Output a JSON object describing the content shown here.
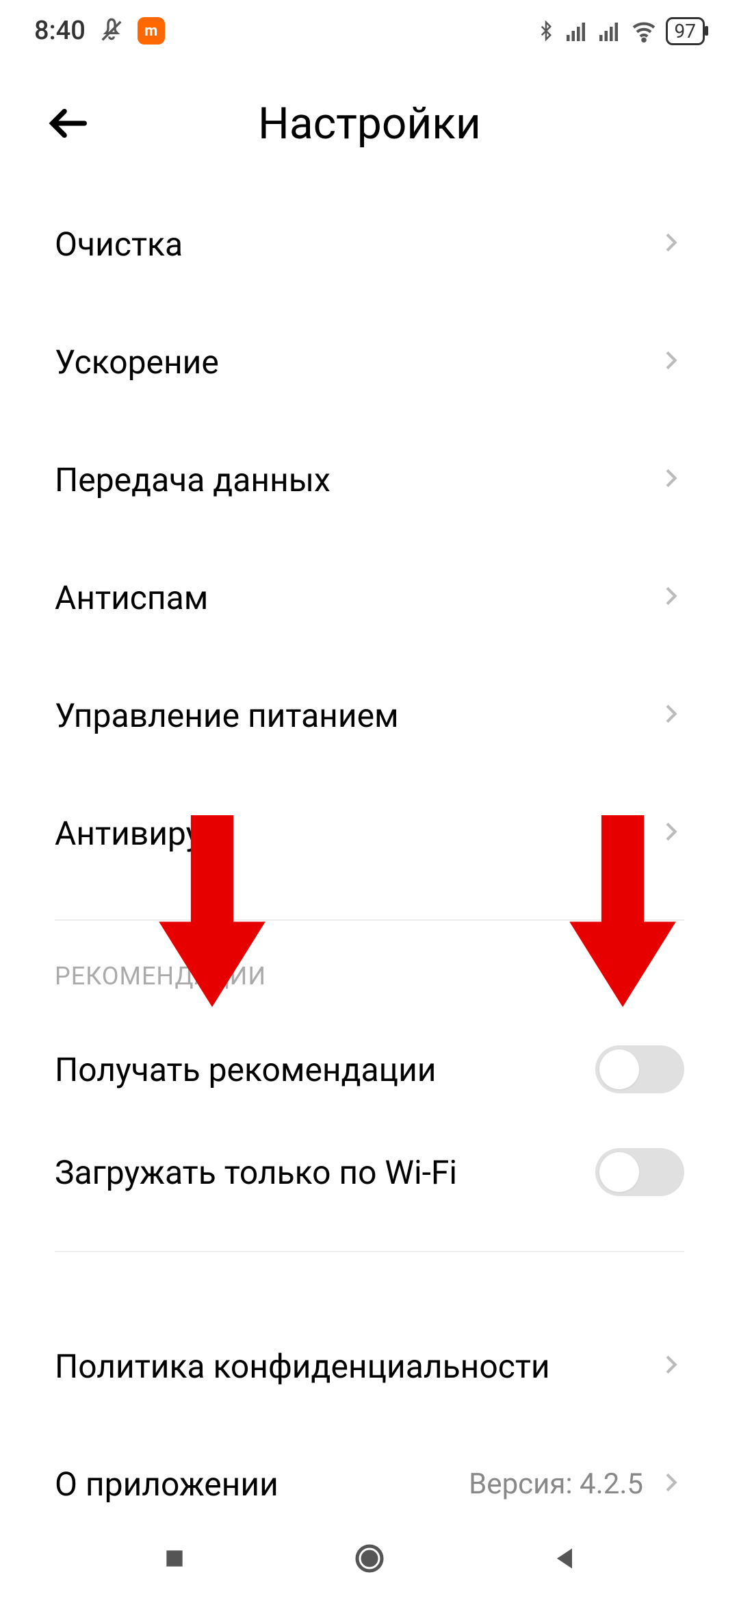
{
  "status": {
    "time": "8:40",
    "battery": "97"
  },
  "header": {
    "title": "Настройки"
  },
  "items": [
    {
      "label": "Очистка"
    },
    {
      "label": "Ускорение"
    },
    {
      "label": "Передача данных"
    },
    {
      "label": "Антиспам"
    },
    {
      "label": "Управление питанием"
    },
    {
      "label": "Антивирус"
    }
  ],
  "section": {
    "label": "РЕКОМЕНДАЦИИ"
  },
  "toggles": [
    {
      "label": "Получать рекомендации"
    },
    {
      "label": "Загружать только по Wi-Fi"
    }
  ],
  "bottom": [
    {
      "label": "Политика конфиденциальности",
      "secondary": ""
    },
    {
      "label": "О приложении",
      "secondary": "Версия: 4.2.5"
    }
  ]
}
